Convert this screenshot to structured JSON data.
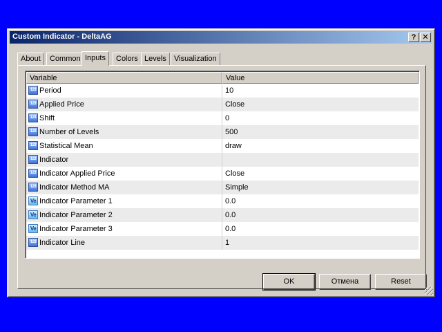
{
  "window": {
    "title": "Custom Indicator - DeltaAG",
    "help_label": "?",
    "close_label": "✕"
  },
  "tabs": [
    {
      "label": "About"
    },
    {
      "label": "Common"
    },
    {
      "label": "Inputs",
      "active": true
    },
    {
      "label": "Colors"
    },
    {
      "label": "Levels"
    },
    {
      "label": "Visualization"
    }
  ],
  "table": {
    "headers": [
      "Variable",
      "Value"
    ],
    "rows": [
      {
        "icon": "123",
        "variable": "Period",
        "value": "10"
      },
      {
        "icon": "123",
        "variable": "Applied Price",
        "value": "Close"
      },
      {
        "icon": "123",
        "variable": "Shift",
        "value": "0"
      },
      {
        "icon": "123",
        "variable": "Number of Levels",
        "value": "500"
      },
      {
        "icon": "123",
        "variable": "Statistical Mean",
        "value": "draw"
      },
      {
        "icon": "123",
        "variable": "Indicator",
        "value": ""
      },
      {
        "icon": "123",
        "variable": "Indicator Applied Price",
        "value": "Close"
      },
      {
        "icon": "123",
        "variable": "Indicator Method MA",
        "value": "Simple"
      },
      {
        "icon": "Ve",
        "variable": "Indicator Parameter 1",
        "value": "0.0"
      },
      {
        "icon": "Ve",
        "variable": "Indicator Parameter 2",
        "value": "0.0"
      },
      {
        "icon": "Ve",
        "variable": "Indicator Parameter 3",
        "value": "0.0"
      },
      {
        "icon": "123",
        "variable": "Indicator Line",
        "value": "1"
      }
    ]
  },
  "buttons": {
    "ok": "OK",
    "cancel": "Отмена",
    "reset": "Reset"
  },
  "colors": {
    "desktop": "#0000ff",
    "titlebar_start": "#0a246a",
    "titlebar_end": "#a6caf0",
    "dialog_face": "#d4d0c8"
  }
}
